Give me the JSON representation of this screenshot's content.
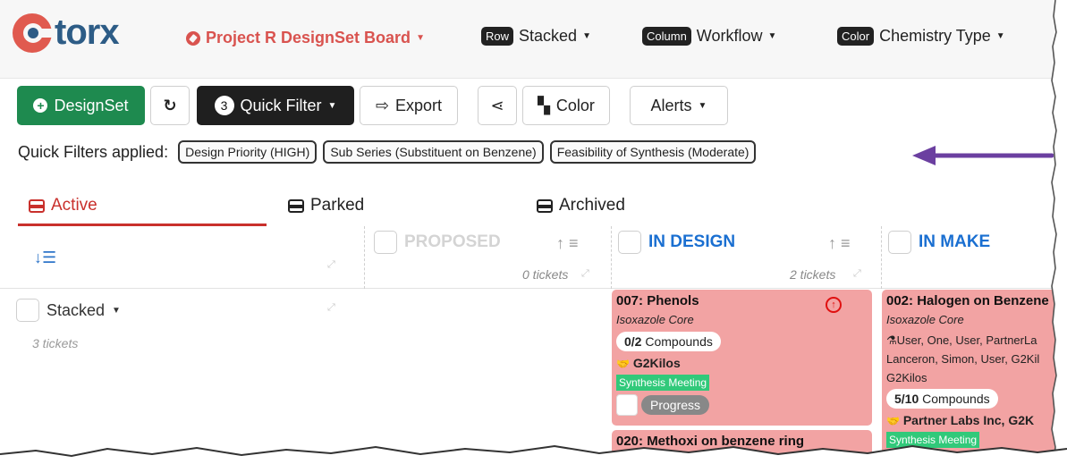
{
  "app": {
    "logo_text": "torx"
  },
  "nav": {
    "board_title": "Project R DesignSet Board",
    "row": {
      "tag": "Row",
      "value": "Stacked"
    },
    "column": {
      "tag": "Column",
      "value": "Workflow"
    },
    "color": {
      "tag": "Color",
      "value": "Chemistry Type"
    }
  },
  "toolbar": {
    "designset_label": "DesignSet",
    "quick_filter_count": "3",
    "quick_filter_label": "Quick Filter",
    "export_label": "Export",
    "color_label": "Color",
    "alerts_label": "Alerts"
  },
  "filters": {
    "label": "Quick Filters applied:",
    "chips": [
      "Design Priority (HIGH)",
      "Sub Series (Substituent on Benzene)",
      "Feasibility of Synthesis (Moderate)"
    ]
  },
  "tabs": [
    "Active",
    "Parked",
    "Archived"
  ],
  "columns": [
    {
      "title": "PROPOSED",
      "tickets": "0 tickets"
    },
    {
      "title": "IN DESIGN",
      "tickets": "2 tickets"
    },
    {
      "title": "IN MAKE",
      "tickets": ""
    }
  ],
  "lane": {
    "label": "Stacked",
    "count": "3 tickets"
  },
  "cards": {
    "c007": {
      "title": "007: Phenols",
      "subtitle": "Isoxazole Core",
      "compounds_num": "0/2",
      "compounds_label": "Compounds",
      "partner": "G2Kilos",
      "meeting": "Synthesis Meeting",
      "progress": "Progress"
    },
    "c020": {
      "title": "020: Methoxi on benzene ring"
    },
    "c002": {
      "title": "002: Halogen on Benzene",
      "subtitle": "Isoxazole Core",
      "people_line1": "User, One, User, PartnerLa",
      "people_line2": "Lanceron, Simon, User, G2Kil",
      "people_line3": "G2Kilos",
      "compounds_num": "5/10",
      "compounds_label": "Compounds",
      "partner": "Partner Labs Inc, G2K",
      "meeting": "Synthesis Meeting"
    }
  },
  "colors": {
    "brand_red": "#d9534f",
    "brand_blue": "#2d5c86",
    "card_pink": "#f2a3a3",
    "active_red": "#c9302c",
    "annotation_purple": "#6b3fa0"
  }
}
